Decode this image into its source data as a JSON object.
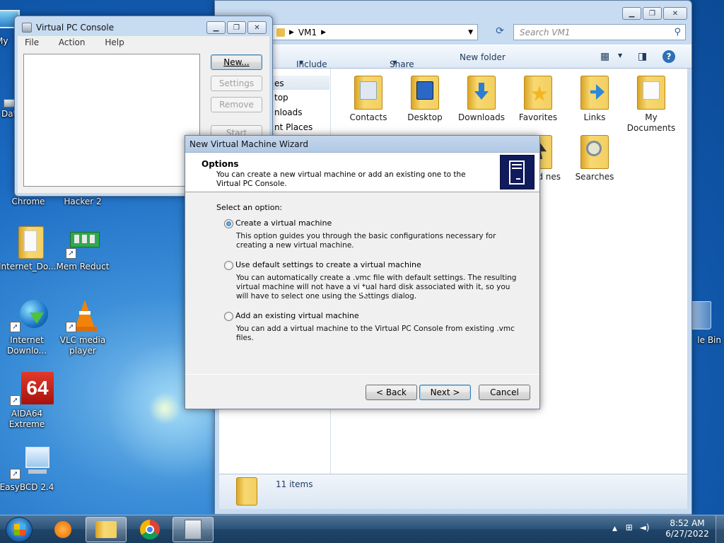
{
  "desktop": {
    "icons": [
      {
        "label": "My",
        "icon": "computer-icon"
      },
      {
        "label": "Dat",
        "icon": "drive-icon"
      },
      {
        "label": "Chrome",
        "icon": "chrome-icon"
      },
      {
        "label": "Hacker 2",
        "icon": "hacker-icon"
      },
      {
        "label": "Internet_Do...",
        "icon": "folder-icon"
      },
      {
        "label": "Mem Reduct",
        "icon": "memory-icon"
      },
      {
        "label": "Internet Downlo...",
        "icon": "idm-icon"
      },
      {
        "label": "VLC media player",
        "icon": "vlc-icon"
      },
      {
        "label": "AIDA64 Extreme",
        "icon": "aida64-icon"
      },
      {
        "label": "EasyBCD 2.4",
        "icon": "easybcd-icon"
      },
      {
        "label": "le Bin",
        "icon": "recycle-bin-icon"
      }
    ],
    "aida_badge": "64"
  },
  "explorer": {
    "breadcrumb": "VM1",
    "search_placeholder": "Search VM1",
    "toolbar": {
      "include": "Include in library",
      "share": "Share with",
      "new_folder": "New folder"
    },
    "nav_items": [
      "es",
      "top",
      "nloads",
      "nt Places"
    ],
    "folders": [
      {
        "label": "Contacts"
      },
      {
        "label": "Desktop"
      },
      {
        "label": "Downloads"
      },
      {
        "label": "Favorites"
      },
      {
        "label": "Links"
      },
      {
        "label": "My Documents"
      },
      {
        "label": "ed nes"
      },
      {
        "label": "Searches"
      }
    ],
    "status": "11 items"
  },
  "vpc_console": {
    "title": "Virtual PC Console",
    "menu": [
      "File",
      "Action",
      "Help"
    ],
    "buttons": {
      "new": "New...",
      "settings": "Settings",
      "remove": "Remove",
      "start": "Start"
    }
  },
  "wizard": {
    "title": "New Virtual Machine Wizard",
    "heading": "Options",
    "subheading": "You can create a new virtual machine or add an existing one to the Virtual PC Console.",
    "prompt": "Select an option:",
    "options": [
      {
        "label": "Create a virtual machine",
        "desc": "This option guides you through the basic configurations necessary for creating a new virtual machine.",
        "selected": true
      },
      {
        "label": "Use default settings to create a virtual machine",
        "desc": "You can automatically create a .vmc file with default settings. The resulting virtual machine will not have a virtual hard disk associated with it, so you will have to select one using the Settings dialog.",
        "selected": false
      },
      {
        "label": "Add an existing virtual machine",
        "desc": "You can add a virtual machine to the Virtual PC Console from existing .vmc files.",
        "selected": false
      }
    ],
    "buttons": {
      "back": "< Back",
      "next": "Next >",
      "cancel": "Cancel"
    }
  },
  "taskbar": {
    "time": "8:52 AM",
    "date": "6/27/2022"
  }
}
